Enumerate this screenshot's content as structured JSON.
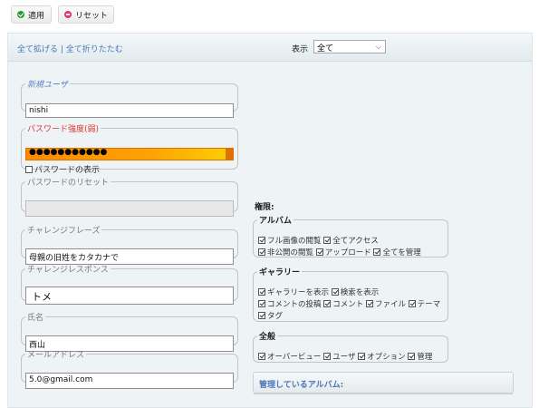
{
  "toolbar": {
    "apply_label": "適用",
    "reset_label": "リセット"
  },
  "header": {
    "expand_collapse": "全て拡げる | 全て折りたたむ",
    "display_label": "表示",
    "display_value": "全て"
  },
  "form": {
    "new_user": {
      "legend": "新規ユーザ",
      "value": "nishi"
    },
    "password": {
      "legend": "パスワード強度(弱)",
      "masked": "●●●●●●●●●●●",
      "show_label": "パスワードの表示",
      "strength_fraction": 0.93
    },
    "password_reset": {
      "legend": "パスワードのリセット",
      "value": ""
    },
    "challenge_phrase": {
      "legend": "チャレンジフレーズ",
      "value": "母親の旧姓をカタカナで"
    },
    "challenge_response": {
      "legend": "チャレンジレスポンス",
      "value": "トメ"
    },
    "name": {
      "legend": "氏名",
      "value": "西山"
    },
    "email": {
      "legend": "メールアドレス",
      "value": "5.0@gmail.com"
    }
  },
  "permissions": {
    "title": "権限:",
    "album": {
      "legend": "アルバム",
      "line1": "フル画像の閲覧",
      "line1b": "全てアクセス",
      "line2": "非公開の閲覧",
      "line2b": "アップロード",
      "line2c": "全てを管理"
    },
    "gallery": {
      "legend": "ギャラリー",
      "line1": "ギャラリーを表示",
      "line1b": "検索を表示",
      "line2": "コメントの投稿",
      "line2b": "コメント",
      "line2c": "ファイル",
      "line2d": "テーマ",
      "line3": "タグ"
    },
    "general": {
      "legend": "全般",
      "line1": "オーバービュー",
      "line1b": "ユーザ",
      "line1c": "オプション",
      "line1d": "管理"
    }
  },
  "managed_albums": {
    "label": "管理しているアルバム:"
  }
}
